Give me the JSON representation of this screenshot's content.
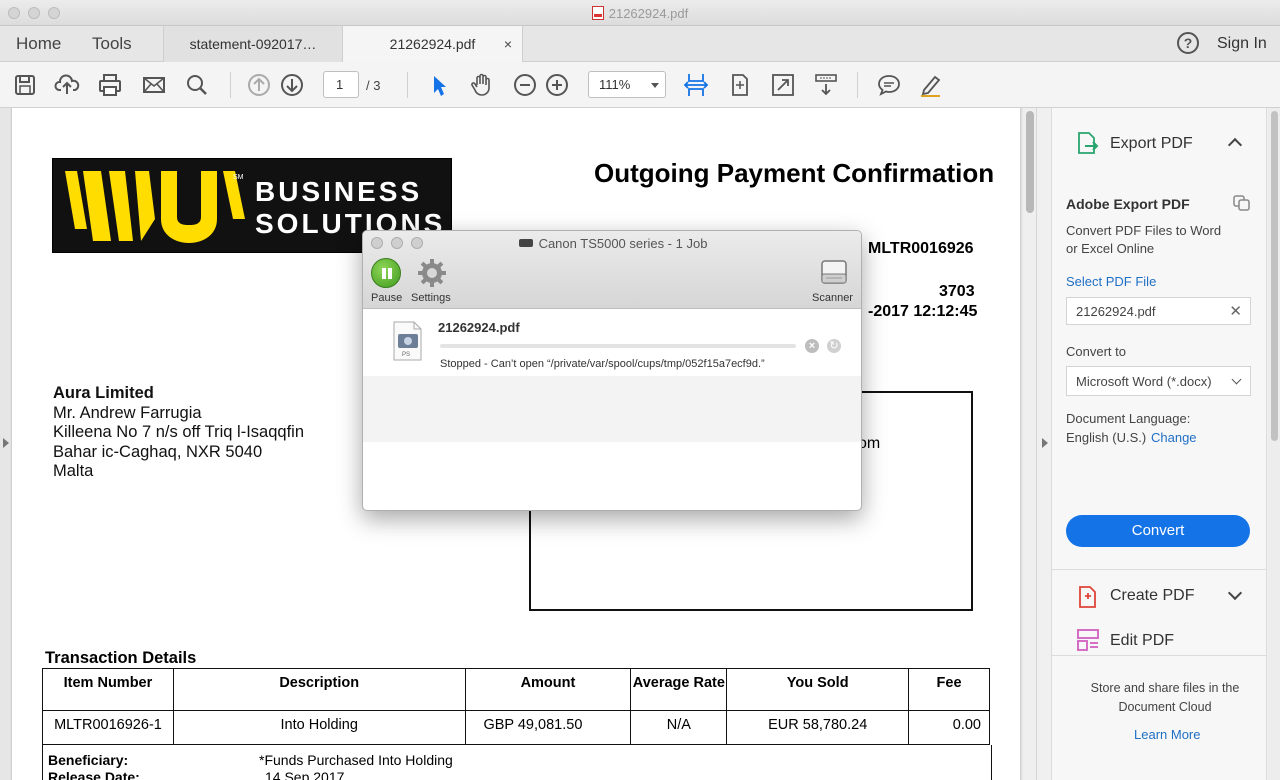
{
  "window": {
    "title": "21262924.pdf"
  },
  "nav": {
    "home": "Home",
    "tools": "Tools",
    "sign_in": "Sign In"
  },
  "tabs": [
    {
      "label": "statement-092017…"
    },
    {
      "label": "21262924.pdf",
      "close": "×"
    }
  ],
  "toolbar": {
    "page_current": "1",
    "page_total": "/ 3",
    "zoom": "111%"
  },
  "document": {
    "logo_line1": "BUSINESS",
    "logo_line2": "SOLUTIONS",
    "title": "Outgoing Payment Confirmation",
    "reference": "MLTR0016926",
    "account_fragment": "3703",
    "datetime_fragment": "-2017 12:12:45",
    "address": {
      "name": "Aura Limited",
      "lines": [
        "Mr. Andrew Farrugia",
        "Killeena No 7 n/s off Triq l-Isaqqfin",
        "Bahar ic-Caghaq,  NXR 5040",
        "Malta"
      ]
    },
    "info_fragment": "om",
    "transaction_heading": "Transaction Details",
    "table": {
      "headers": [
        "Item Number",
        "Description",
        "Amount",
        "Average Rate",
        "You Sold",
        "Fee"
      ],
      "rows": [
        [
          "MLTR0016926-1",
          "Into Holding",
          "GBP 49,081.50",
          "N/A",
          "EUR 58,780.24",
          "0.00"
        ]
      ]
    },
    "beneficiary_label": "Beneficiary:",
    "beneficiary_value": "*Funds Purchased Into Holding",
    "release_label": "Release Date:",
    "release_value": "14 Sep 2017"
  },
  "print_dialog": {
    "title": "Canon TS5000 series - 1 Job",
    "pause_label": "Pause",
    "settings_label": "Settings",
    "scanner_label": "Scanner",
    "job": {
      "name": "21262924.pdf",
      "icon_badge": "PS",
      "progress": 0,
      "status": "Stopped - Can’t open “/private/var/spool/cups/tmp/052f15a7ecf9d.”"
    }
  },
  "right_panel": {
    "export_title": "Export PDF",
    "adobe_export": "Adobe Export PDF",
    "description": "Convert PDF Files to Word or Excel Online",
    "select_file": "Select PDF File",
    "file_name": "21262924.pdf",
    "convert_to_label": "Convert to",
    "convert_to_value": "Microsoft Word (*.docx)",
    "doc_lang_label": "Document Language:",
    "doc_lang_value": "English (U.S.)",
    "change_link": "Change",
    "convert_button": "Convert",
    "create_pdf": "Create PDF",
    "edit_pdf": "Edit PDF",
    "cloud_text": "Store and share files in the Document Cloud",
    "learn_more": "Learn More"
  },
  "colors": {
    "accent": "#1473e6",
    "link": "#1f6fc5",
    "wu_yellow": "#ffdd00",
    "export_green": "#2aa570",
    "create_red": "#e0453a",
    "edit_pink": "#d05ec0"
  }
}
